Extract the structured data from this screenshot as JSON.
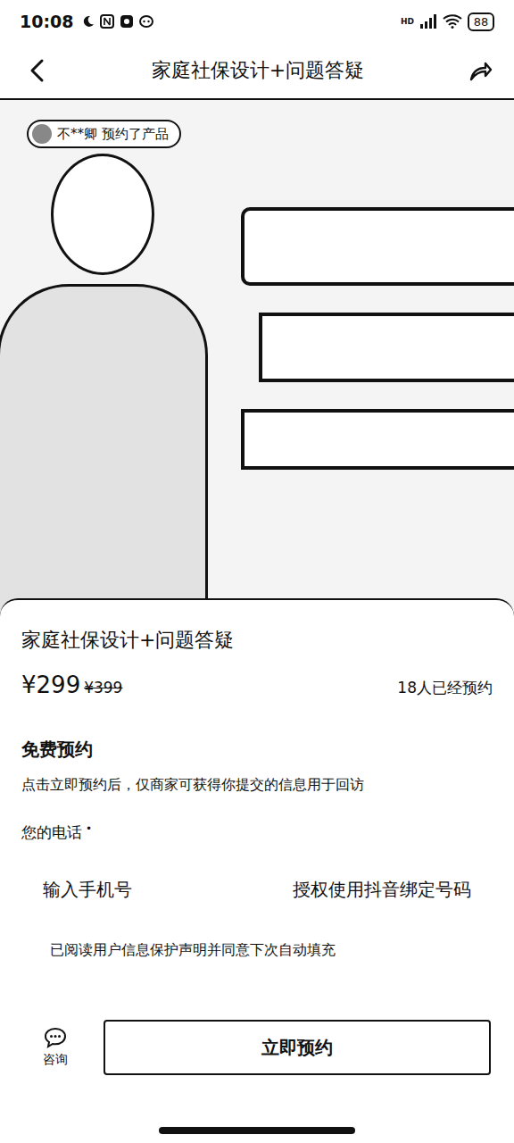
{
  "status_bar": {
    "time": "10:08",
    "network": "HD",
    "battery": "88"
  },
  "header": {
    "title": "家庭社保设计+问题答疑"
  },
  "banner": {
    "badge": "不**卿 预约了产品"
  },
  "product": {
    "title": "家庭社保设计+问题答疑",
    "price": "¥299",
    "original_price": "¥399",
    "booked": "18人已经预约"
  },
  "form": {
    "heading": "免费预约",
    "notice": "点击立即预约后，仅商家可获得你提交的信息用于回访",
    "phone_label": "您的电话",
    "required_mark": "•",
    "phone_placeholder": "输入手机号",
    "authorize": "授权使用抖音绑定号码",
    "consent": "已阅读用户信息保护声明并同意下次自动填充"
  },
  "bottom_bar": {
    "consult": "咨询",
    "submit": "立即预约"
  }
}
